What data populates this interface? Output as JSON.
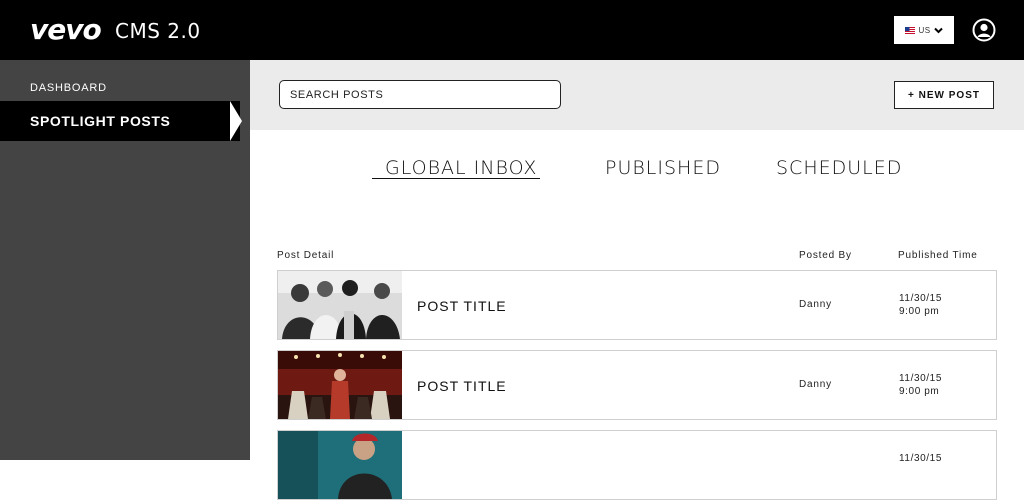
{
  "header": {
    "logo": "vevo",
    "app_version": "CMS 2.0",
    "locale": "US",
    "icons": {
      "flag": "us-flag-icon",
      "chevron": "chevron-down-icon",
      "user": "user-icon"
    }
  },
  "sidebar": {
    "items": [
      {
        "label": "DASHBOARD",
        "active": false
      },
      {
        "label": "SPOTLIGHT POSTS",
        "active": true
      }
    ]
  },
  "toolbar": {
    "search_placeholder": "SEARCH POSTS",
    "search_value": "",
    "new_post_label": "+ NEW POST"
  },
  "tabs": [
    {
      "label": "GLOBAL INBOX",
      "active": true
    },
    {
      "label": "PUBLISHED",
      "active": false
    },
    {
      "label": "SCHEDULED",
      "active": false
    }
  ],
  "table": {
    "columns": [
      "Post Detail",
      "Posted By",
      "Published Time"
    ],
    "rows": [
      {
        "title": "POST TITLE",
        "posted_by": "Danny",
        "date": "11/30/15",
        "time": "9:00 pm"
      },
      {
        "title": "POST TITLE",
        "posted_by": "Danny",
        "date": "11/30/15",
        "time": "9:00 pm"
      },
      {
        "title": "",
        "posted_by": "",
        "date": "11/30/15",
        "time": ""
      }
    ]
  },
  "colors": {
    "topbar": "#000000",
    "sidebar": "#444444",
    "toolbar": "#ebebeb",
    "row_border": "#cfcfcf"
  }
}
